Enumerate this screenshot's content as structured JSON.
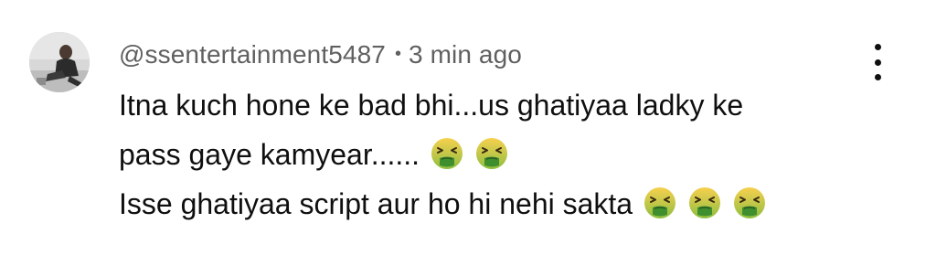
{
  "comment": {
    "author": "@ssentertainment5487",
    "separator": "•",
    "timestamp": "3 min ago",
    "avatar_icon": "user-avatar-photo",
    "more_icon": "more-vertical-icon",
    "emoji_icon": "nauseated-face-emoji",
    "lines": [
      "Itna kuch hone ke bad bhi...us ghatiyaa ladky ke",
      "pass gaye kamyear......",
      "Isse ghatiyaa script aur ho hi nehi sakta "
    ],
    "colors": {
      "meta_text": "#606060",
      "body_text": "#0f0f0f",
      "emoji_face": "#8fbf3f",
      "emoji_drip": "#3f8f2f"
    }
  }
}
